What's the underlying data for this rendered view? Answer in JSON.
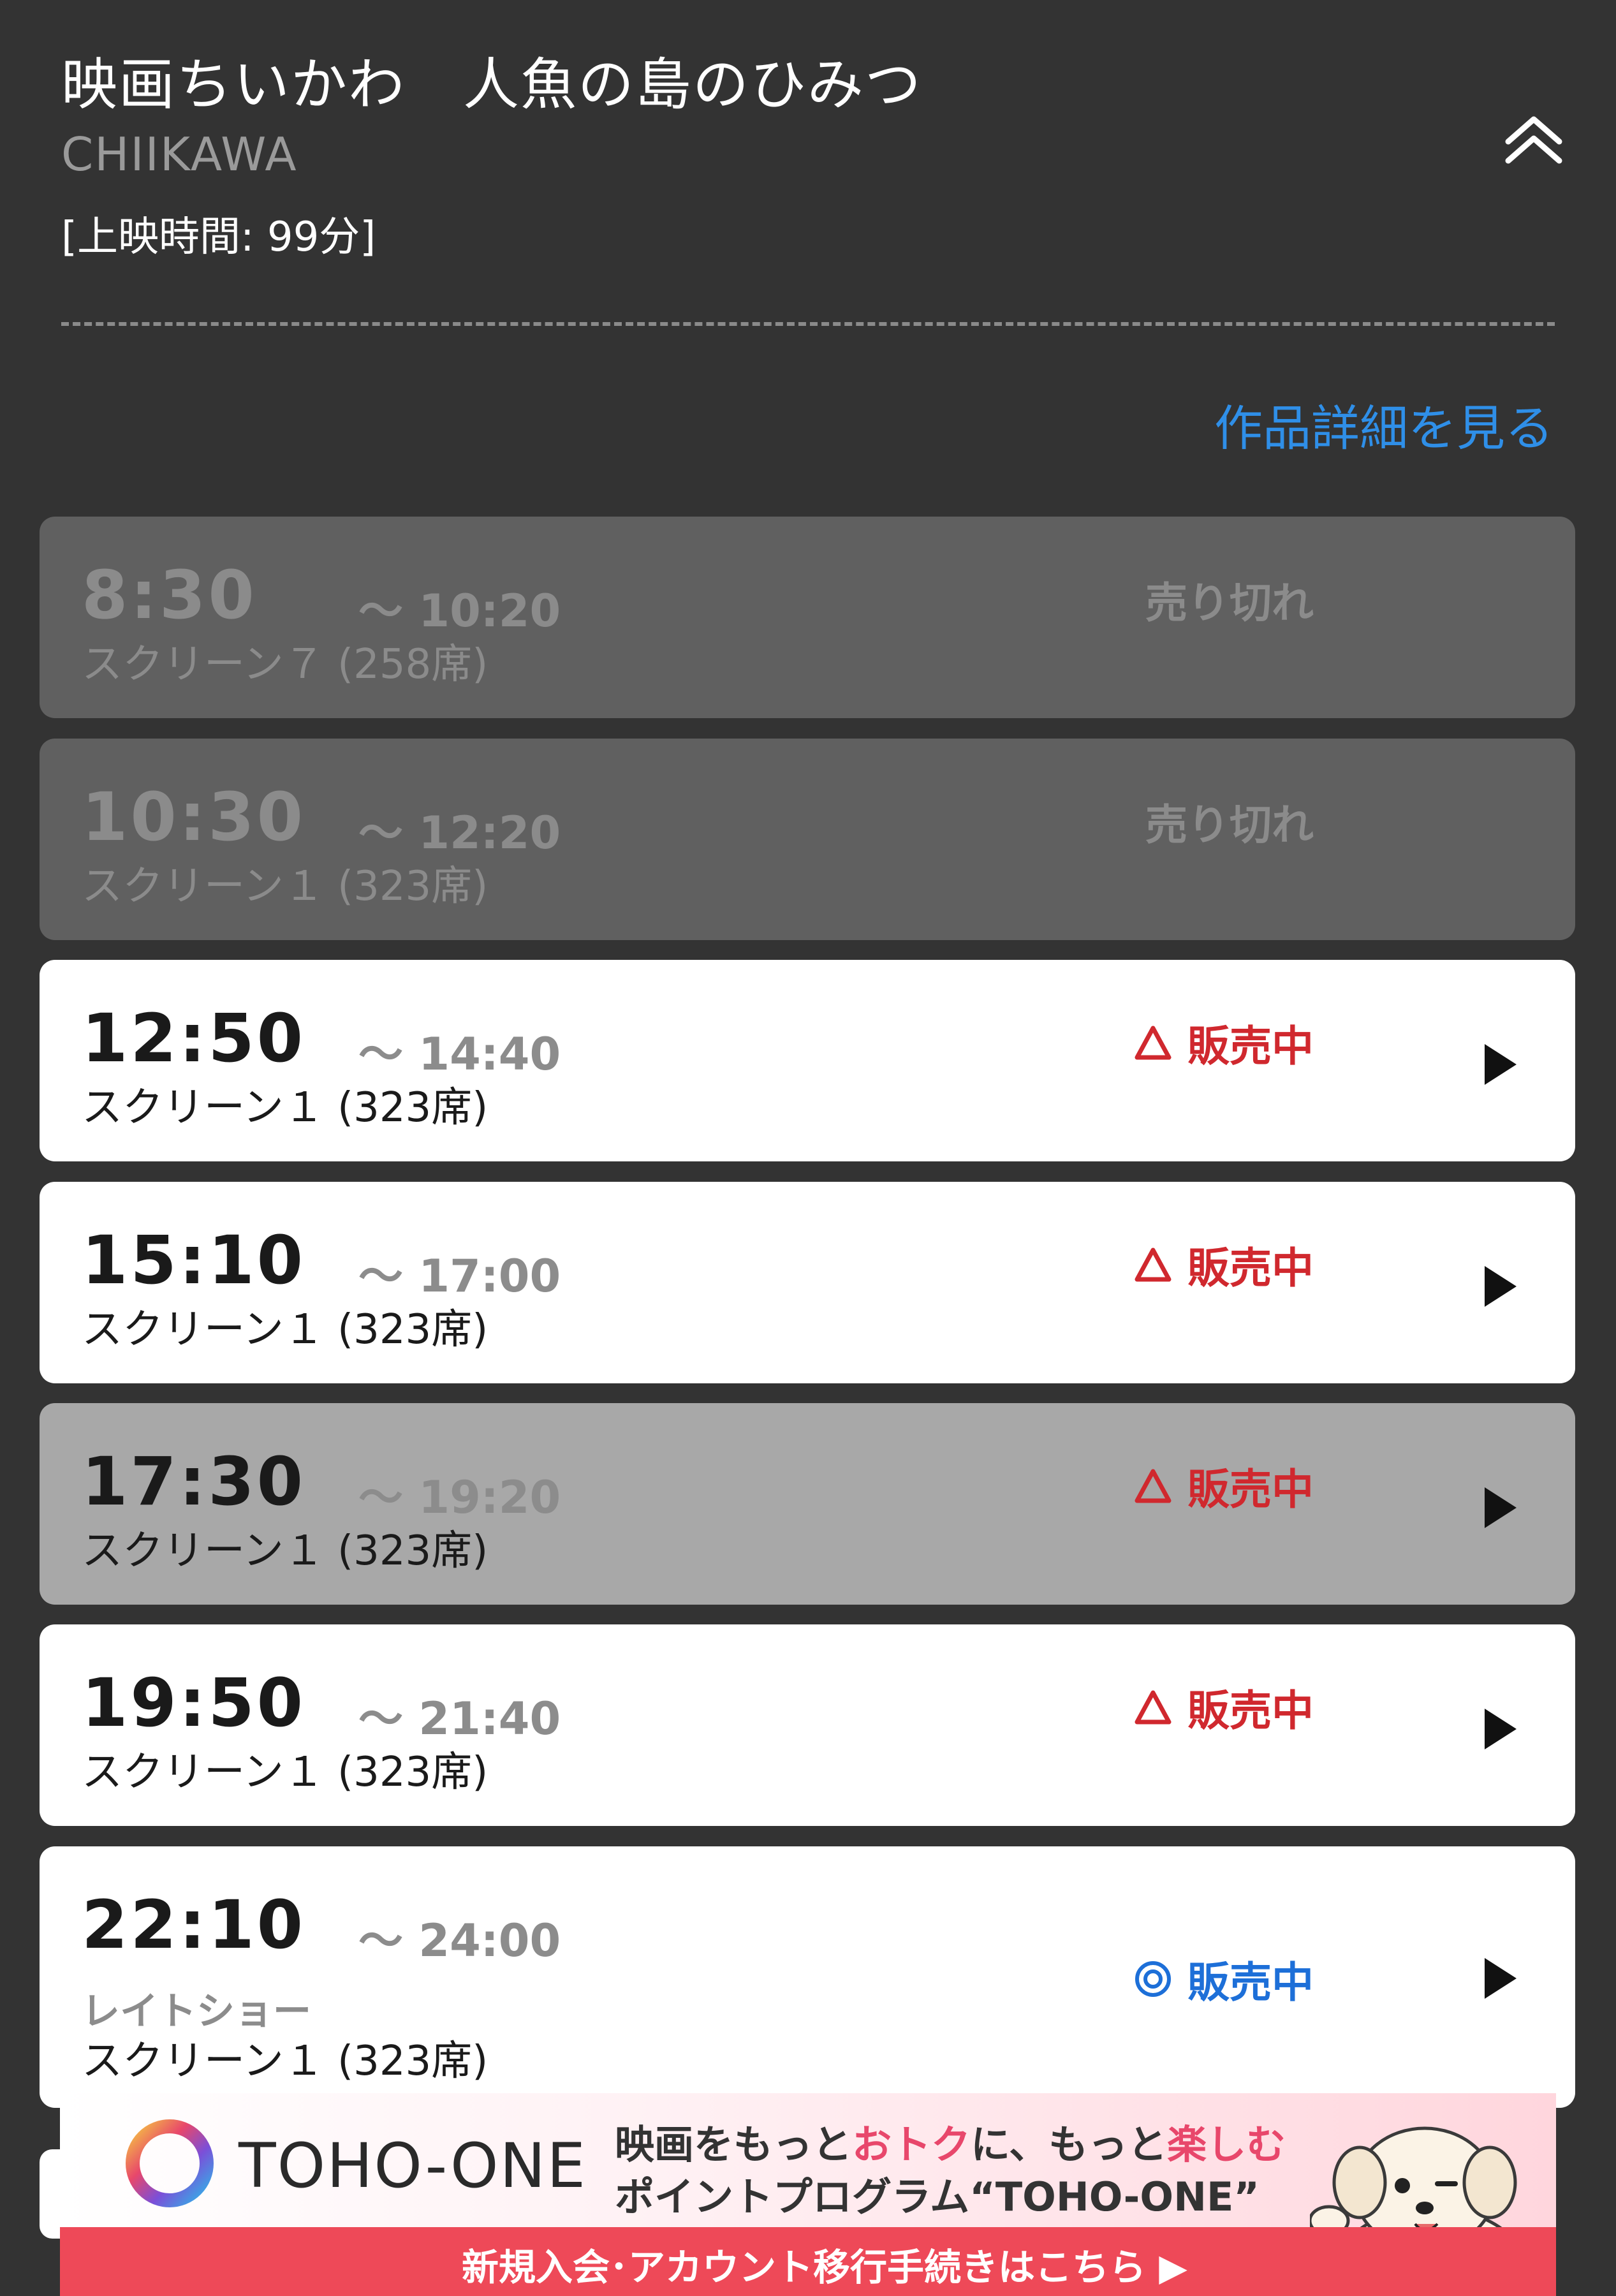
{
  "movie": {
    "title": "映画ちいかわ　人魚の島のひみつ",
    "subtitle": "CHIIKAWA",
    "runtime": "[上映時間: 99分]",
    "details_link": "作品詳細を見る"
  },
  "showings": [
    {
      "start": "8:30",
      "end": "〜 10:20",
      "screen": "スクリーン７ (258席)",
      "note": "",
      "status": "売り切れ",
      "status_icon": "none",
      "state": "soldout"
    },
    {
      "start": "10:30",
      "end": "〜 12:20",
      "screen": "スクリーン１ (323席)",
      "note": "",
      "status": "売り切れ",
      "status_icon": "none",
      "state": "soldout"
    },
    {
      "start": "12:50",
      "end": "〜 14:40",
      "screen": "スクリーン１ (323席)",
      "note": "",
      "status": "販売中",
      "status_icon": "triangle-icon",
      "state": "available"
    },
    {
      "start": "15:10",
      "end": "〜 17:00",
      "screen": "スクリーン１ (323席)",
      "note": "",
      "status": "販売中",
      "status_icon": "triangle-icon",
      "state": "available"
    },
    {
      "start": "17:30",
      "end": "〜 19:20",
      "screen": "スクリーン１ (323席)",
      "note": "",
      "status": "販売中",
      "status_icon": "triangle-icon",
      "state": "pressed"
    },
    {
      "start": "19:50",
      "end": "〜 21:40",
      "screen": "スクリーン１ (323席)",
      "note": "",
      "status": "販売中",
      "status_icon": "triangle-icon",
      "state": "available"
    },
    {
      "start": "22:10",
      "end": "〜 24:00",
      "screen": "スクリーン１ (323席)",
      "note": "レイトショー",
      "status": "販売中",
      "status_icon": "double-circle-icon",
      "state": "available"
    }
  ],
  "banner": {
    "brand": "TOHO-ONE",
    "copy_line1_a": "映画をもっと",
    "copy_line1_b": "おトク",
    "copy_line1_c": "に、もっと",
    "copy_line1_d": "楽しむ",
    "copy_line2": "ポイントプログラム“TOHO-ONE”",
    "cta": "新規入会･アカウント移行手続きはこちら ▶"
  },
  "colors": {
    "background": "#333333",
    "link": "#2f8fe8",
    "status_red": "#d0282e",
    "status_blue": "#1d6fd8",
    "banner_bar": "#ee4958"
  }
}
